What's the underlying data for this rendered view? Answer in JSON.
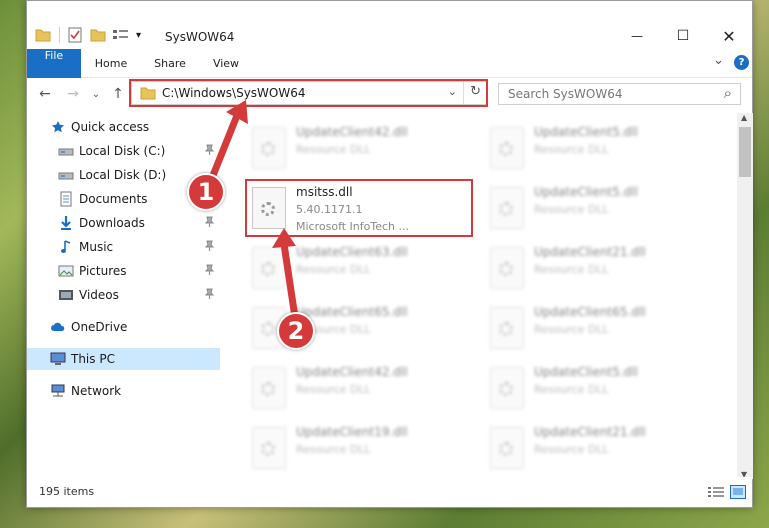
{
  "window": {
    "title": "SysWOW64",
    "controls": {
      "minimize": "—",
      "maximize": "☐",
      "close": "✕"
    }
  },
  "ribbon": {
    "tabs": [
      "File",
      "Home",
      "Share",
      "View"
    ],
    "expand": "⌄",
    "help": "?"
  },
  "nav": {
    "back": "←",
    "forward": "→",
    "recent": "⌄",
    "up": "↑",
    "address": "C:\\Windows\\SysWOW64",
    "address_dropdown": "⌄",
    "refresh": "↻",
    "search_placeholder": "Search SysWOW64",
    "search_icon": "⌕"
  },
  "sidebar": {
    "items": [
      {
        "label": "Quick access",
        "icon": "star-icon",
        "pinned": false
      },
      {
        "label": "Local Disk (C:)",
        "icon": "drive-icon",
        "pinned": true
      },
      {
        "label": "Local Disk (D:)",
        "icon": "drive-icon",
        "pinned": false
      },
      {
        "label": "Documents",
        "icon": "documents-icon",
        "pinned": true
      },
      {
        "label": "Downloads",
        "icon": "downloads-icon",
        "pinned": true
      },
      {
        "label": "Music",
        "icon": "music-icon",
        "pinned": true
      },
      {
        "label": "Pictures",
        "icon": "pictures-icon",
        "pinned": true
      },
      {
        "label": "Videos",
        "icon": "videos-icon",
        "pinned": true
      },
      {
        "label": "OneDrive",
        "icon": "cloud-icon",
        "pinned": false
      },
      {
        "label": "This PC",
        "icon": "pc-icon",
        "pinned": false,
        "selected": true
      },
      {
        "label": "Network",
        "icon": "network-icon",
        "pinned": false
      }
    ],
    "pin_glyph": "📌"
  },
  "files": {
    "highlighted": {
      "name": "msitss.dll",
      "version": "5.40.1171.1",
      "company": "Microsoft InfoTech ..."
    },
    "blurred": [
      {
        "name": "UpdateClient42.dll",
        "type": "Resource DLL"
      },
      {
        "name": "UpdateClient5.dll",
        "type": "Resource DLL"
      },
      {
        "name": "UpdateClient5.dll",
        "type": "Resource DLL"
      },
      {
        "name": "UpdateClient63.dll",
        "type": "Resource DLL"
      },
      {
        "name": "UpdateClient21.dll",
        "type": "Resource DLL"
      },
      {
        "name": "UpdateClient65.dll",
        "type": "Resource DLL"
      },
      {
        "name": "UpdateClient65.dll",
        "type": "Resource DLL"
      },
      {
        "name": "UpdateClient42.dll",
        "type": "Resource DLL"
      },
      {
        "name": "UpdateClient5.dll",
        "type": "Resource DLL"
      },
      {
        "name": "UpdateClient19.dll",
        "type": "Resource DLL"
      },
      {
        "name": "UpdateClient21.dll",
        "type": "Resource DLL"
      }
    ]
  },
  "status": {
    "count": "195 items"
  },
  "annotations": {
    "step1": "1",
    "step2": "2"
  },
  "colors": {
    "accent": "#1a6fc4",
    "annotation": "#d43a3a",
    "selected": "#cce8ff"
  }
}
